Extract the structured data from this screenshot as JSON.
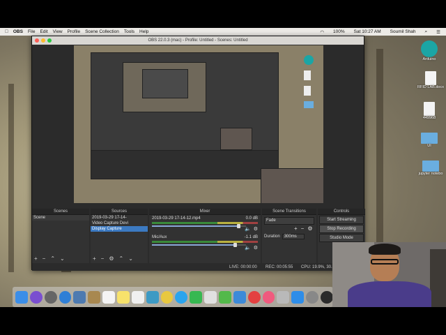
{
  "menubar": {
    "apple": "",
    "app_name": "OBS",
    "items": [
      "File",
      "Edit",
      "View",
      "Profile",
      "Scene Collection",
      "Tools",
      "Help"
    ],
    "battery": "100%",
    "clock": "Sat 10:27 AM",
    "user": "Soumil Shah"
  },
  "window": {
    "title": "OBS 22.0.3 (mac) - Profile: Untitled - Scenes: Untitled"
  },
  "docks": {
    "scenes": {
      "title": "Scenes",
      "items": [
        "Scene"
      ]
    },
    "sources": {
      "title": "Sources",
      "items": [
        "2019-03-29 17-14-",
        "Video Capture Devi",
        "Display Capture"
      ]
    },
    "mixer": {
      "title": "Mixer",
      "channels": [
        {
          "name": "2019-03-29 17-14-12.mp4",
          "db": "0.0 dB",
          "level": 0.92
        },
        {
          "name": "Mic/Aux",
          "db": "-1.1 dB",
          "level": 0.88
        }
      ]
    },
    "transitions": {
      "title": "Scene Transitions",
      "type": "Fade",
      "duration_label": "Duration",
      "duration_value": "300ms"
    },
    "controls": {
      "title": "Controls",
      "buttons": [
        "Start Streaming",
        "Stop Recording",
        "Studio Mode"
      ]
    }
  },
  "status": {
    "live": "LIVE: 00:00:00",
    "rec": "REC: 00:05:55",
    "cpu": "CPU: 19.9%, 30."
  },
  "desktop_icons": [
    "Arduino",
    "RFID LAB.docx",
    "449968",
    "UI",
    "jupyter notebo"
  ]
}
